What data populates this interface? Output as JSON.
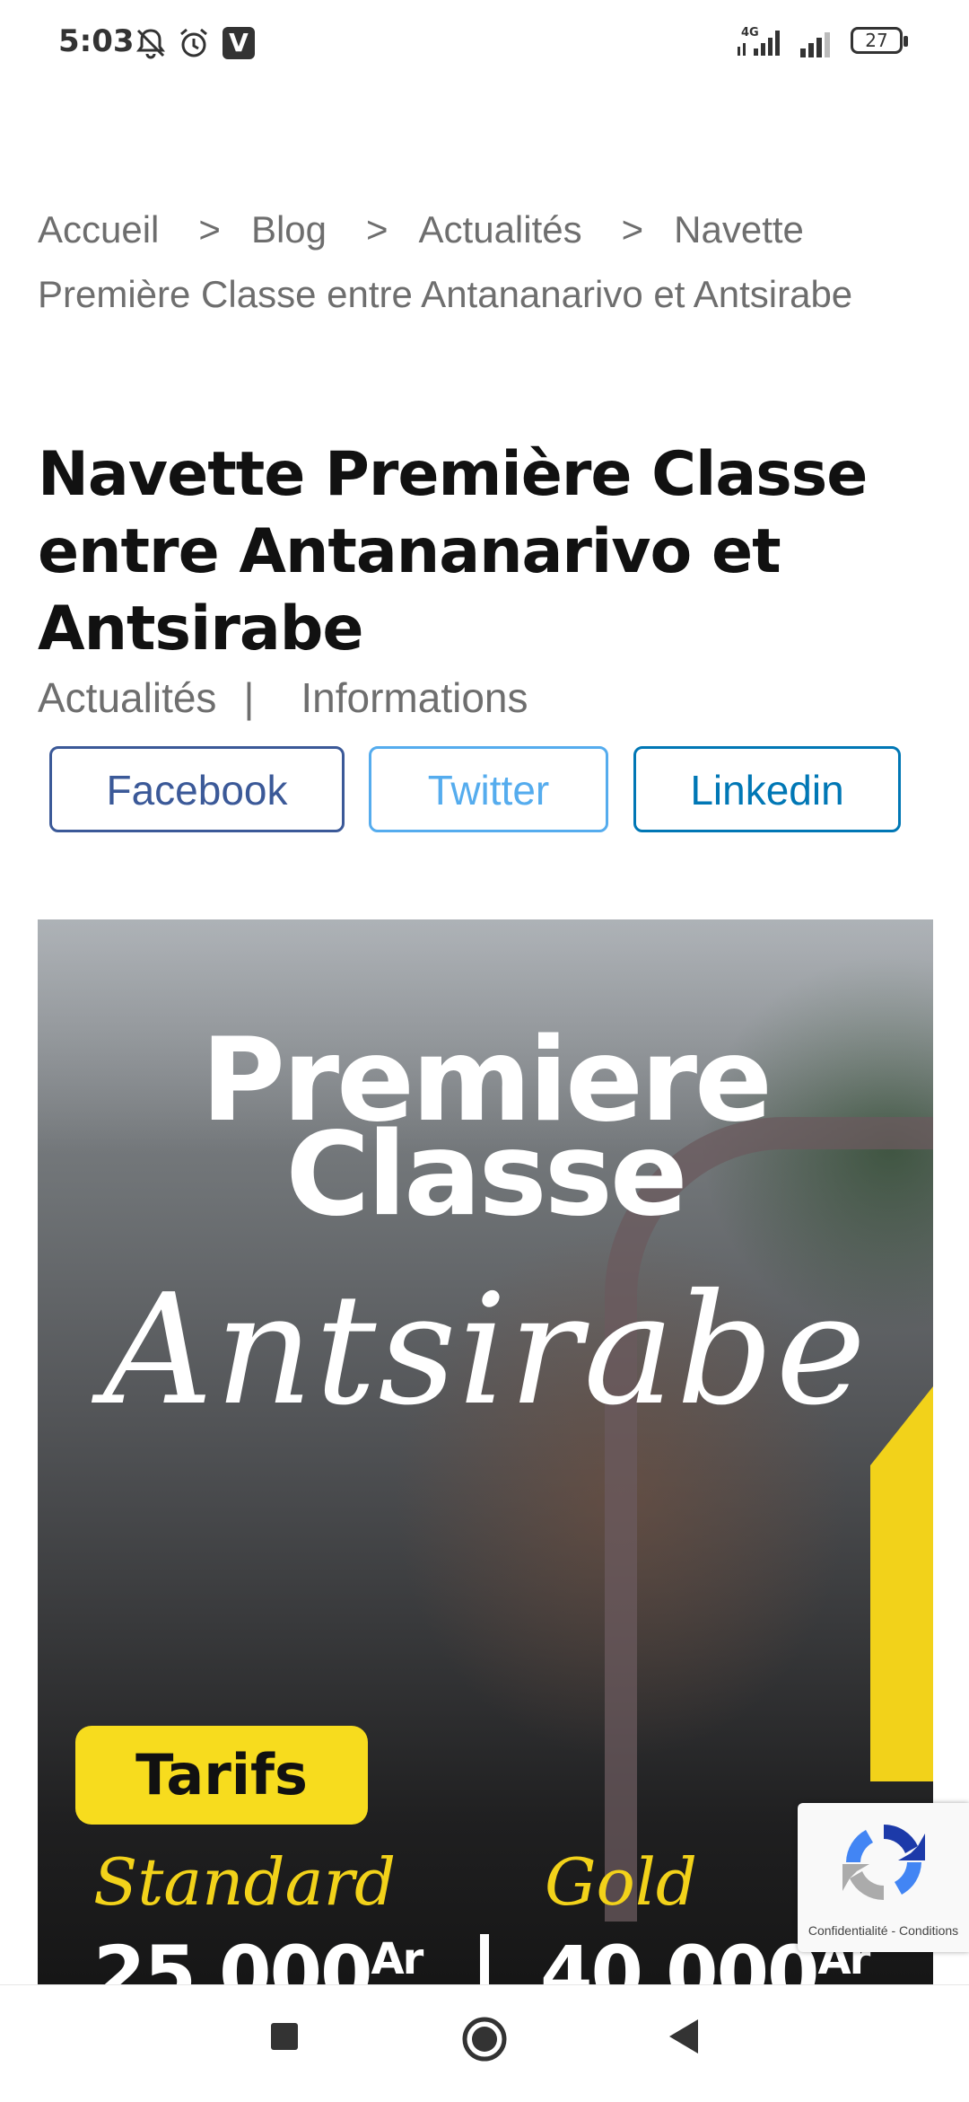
{
  "status_bar": {
    "time": "5:03",
    "icons": [
      "bell-off-icon",
      "alarm-icon",
      "v-app-icon",
      "signal-4g-icon",
      "signal-icon",
      "battery-icon"
    ],
    "v_badge": "V",
    "network": "4G",
    "battery": "27"
  },
  "breadcrumb": {
    "items": [
      "Accueil",
      "Blog",
      "Actualités",
      "Navette Première Classe entre Antananarivo et Antsirabe"
    ],
    "separator": ">"
  },
  "article": {
    "title": "Navette Première Classe entre Antananarivo et Antsirabe",
    "categories": [
      "Actualités",
      "Informations"
    ],
    "category_separator": "|"
  },
  "share": {
    "facebook": "Facebook",
    "twitter": "Twitter",
    "linkedin": "Linkedin",
    "colors": {
      "facebook": "#3b5998",
      "twitter": "#55acee",
      "linkedin": "#0077b5"
    }
  },
  "hero": {
    "headline_line1": "Premiere",
    "headline_line2": "Classe",
    "script_text": "Antsirabe",
    "tarifs_label": "Tarifs",
    "tier_standard": "Standard",
    "tier_gold": "Gold",
    "price_standard": "25 000",
    "price_gold": "40 000",
    "currency": "Ar",
    "accent_color": "#f2d21a"
  },
  "recaptcha": {
    "privacy": "Confidentialité",
    "dash": "-",
    "terms": "Conditions"
  },
  "nav_bar": {
    "icons": [
      "recent-apps-icon",
      "home-icon",
      "back-icon"
    ]
  }
}
